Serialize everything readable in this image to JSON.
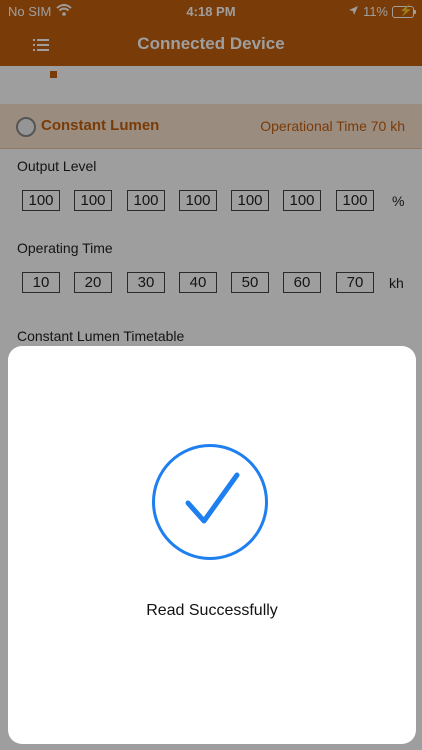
{
  "status_bar": {
    "carrier": "No SIM",
    "time": "4:18 PM",
    "battery": "11%"
  },
  "nav": {
    "title": "Connected Device"
  },
  "section": {
    "label": "Constant Lumen",
    "operational_time": "Operational Time 70 kh"
  },
  "output_level": {
    "label": "Output Level",
    "values": [
      "100",
      "100",
      "100",
      "100",
      "100",
      "100",
      "100"
    ],
    "unit": "%"
  },
  "operating_time": {
    "label": "Operating Time",
    "values": [
      "10",
      "20",
      "30",
      "40",
      "50",
      "60",
      "70"
    ],
    "unit": "kh"
  },
  "timetable": {
    "label": "Constant Lumen Timetable"
  },
  "modal": {
    "message": "Read Successfully"
  },
  "colors": {
    "brand": "#c4600c",
    "accent": "#1e7ff0"
  },
  "icons": [
    "menu-icon",
    "wifi-icon",
    "location-arrow-icon",
    "battery-icon",
    "checkmark-icon"
  ]
}
